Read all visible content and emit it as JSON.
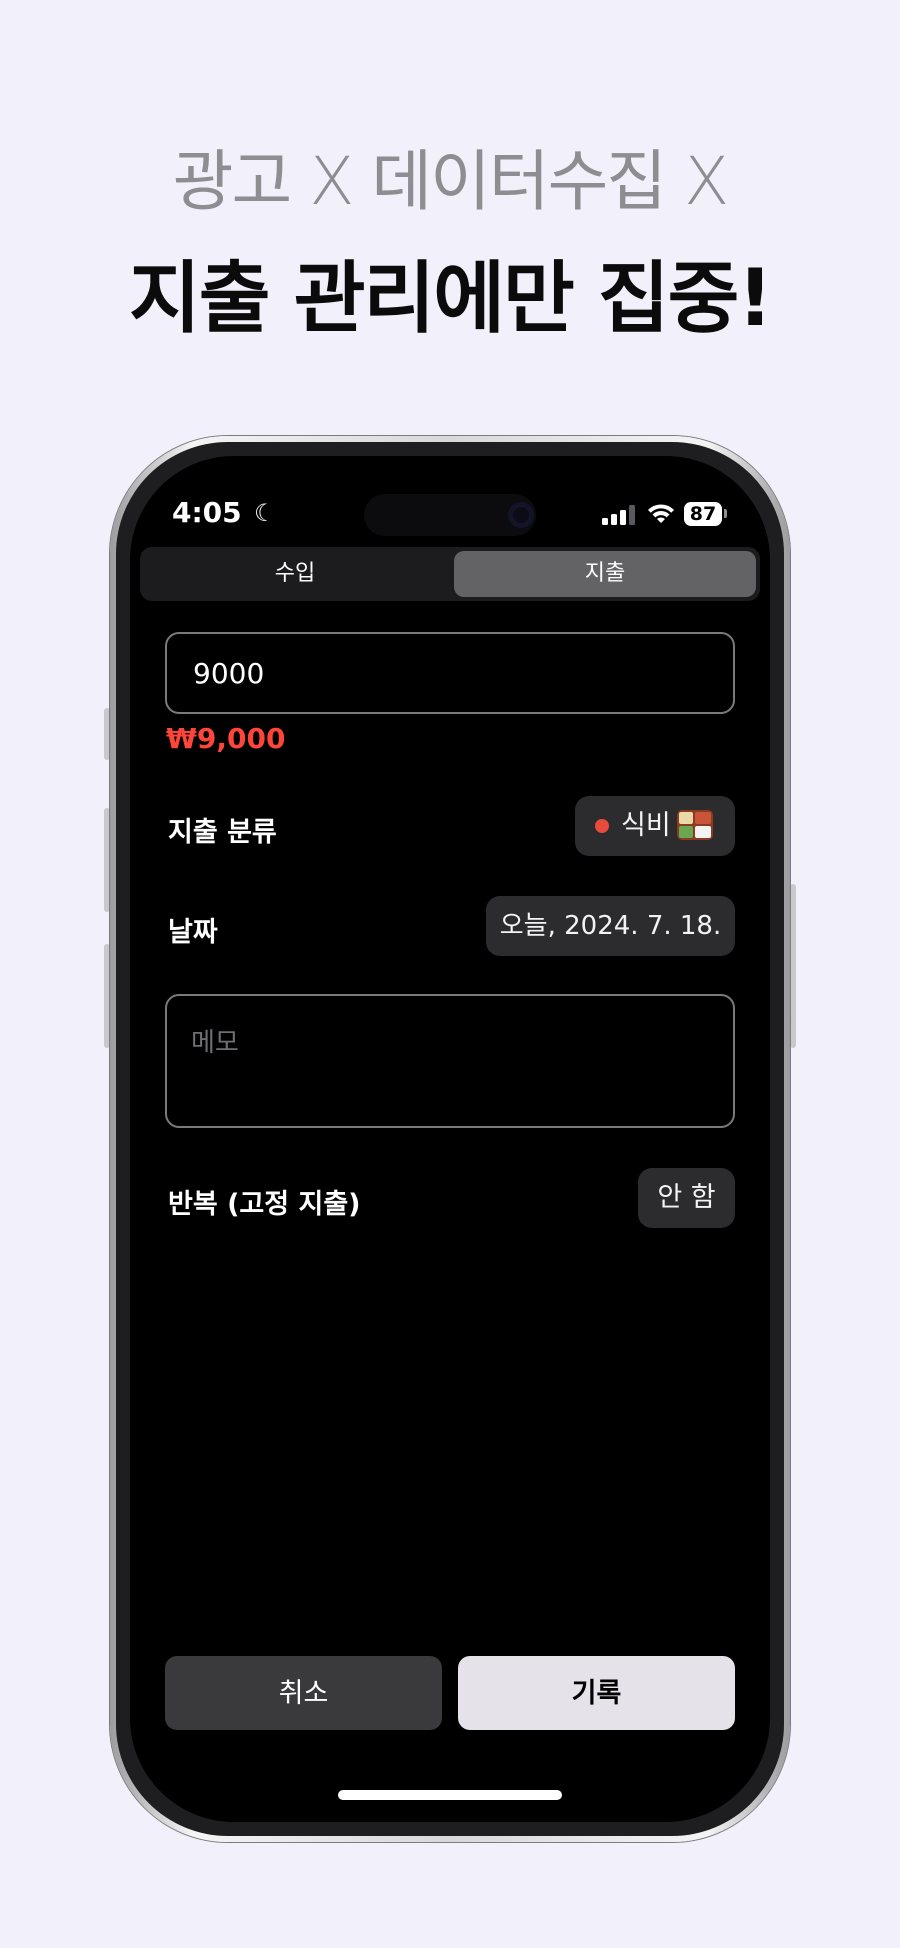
{
  "headline": {
    "line1": "광고 X 데이터수집 X",
    "line2": "지출 관리에만 집중!"
  },
  "status_bar": {
    "time": "4:05",
    "battery": "87",
    "icons": [
      "moon-icon",
      "signal-icon",
      "wifi-icon",
      "battery-icon"
    ]
  },
  "segmented": {
    "income_label": "수입",
    "expense_label": "지출",
    "selected": "expense"
  },
  "amount": {
    "value": "9000",
    "formatted": "₩9,000"
  },
  "category": {
    "label": "지출 분류",
    "value": "식비",
    "dot_color": "#e84a3c",
    "icon": "bento-box-icon"
  },
  "date": {
    "label": "날짜",
    "value": "오늘, 2024. 7. 18."
  },
  "memo": {
    "placeholder": "메모",
    "value": ""
  },
  "repeat": {
    "label": "반복 (고정 지출)",
    "value": "안 함"
  },
  "actions": {
    "cancel_label": "취소",
    "record_label": "기록"
  },
  "colors": {
    "background": "#f1f0fb",
    "accent_negative": "#ff453a",
    "pill_bg": "#2c2c2e",
    "record_button_bg": "#e5e2ea"
  }
}
